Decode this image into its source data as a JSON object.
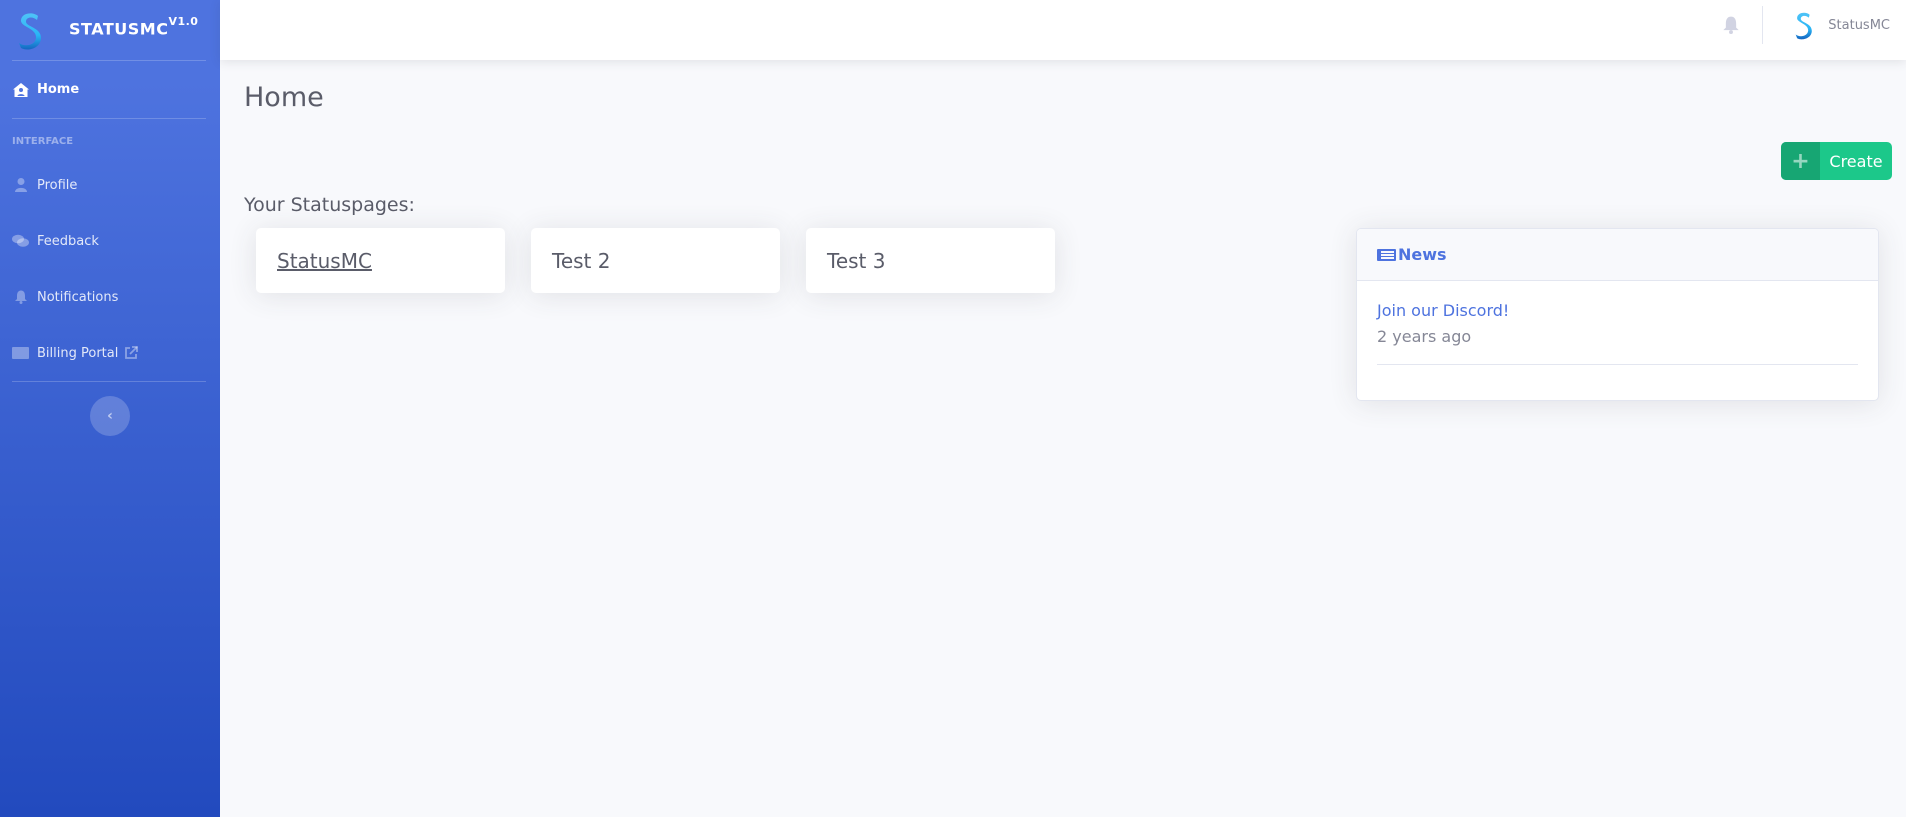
{
  "sidebar": {
    "brand": {
      "name": "STATUSMC",
      "version": "V1.0"
    },
    "home": {
      "label": "Home",
      "icon": "home-user-icon"
    },
    "heading": "INTERFACE",
    "items": [
      {
        "label": "Profile",
        "icon": "user-icon"
      },
      {
        "label": "Feedback",
        "icon": "comments-icon"
      },
      {
        "label": "Notifications",
        "icon": "bell-icon"
      },
      {
        "label": "Billing Portal",
        "icon": "money-bill-icon",
        "external": true
      }
    ],
    "toggle": "‹"
  },
  "topbar": {
    "bell_icon": "bell-icon",
    "user_name": "StatusMC"
  },
  "main": {
    "title": "Home",
    "create_button": {
      "icon": "+",
      "label": "Create"
    },
    "section_label": "Your Statuspages:",
    "statuspages": [
      {
        "name": "StatusMC",
        "underlined": true
      },
      {
        "name": "Test 2"
      },
      {
        "name": "Test 3"
      }
    ]
  },
  "news": {
    "title": "News",
    "icon": "newspaper-icon",
    "items": [
      {
        "title": "Join our Discord!",
        "time": "2 years ago"
      }
    ]
  },
  "colors": {
    "primary": "#4e73df",
    "success": "#1cc88a",
    "success_dark": "#17a673",
    "text": "#5a5c69",
    "muted": "#858796"
  }
}
